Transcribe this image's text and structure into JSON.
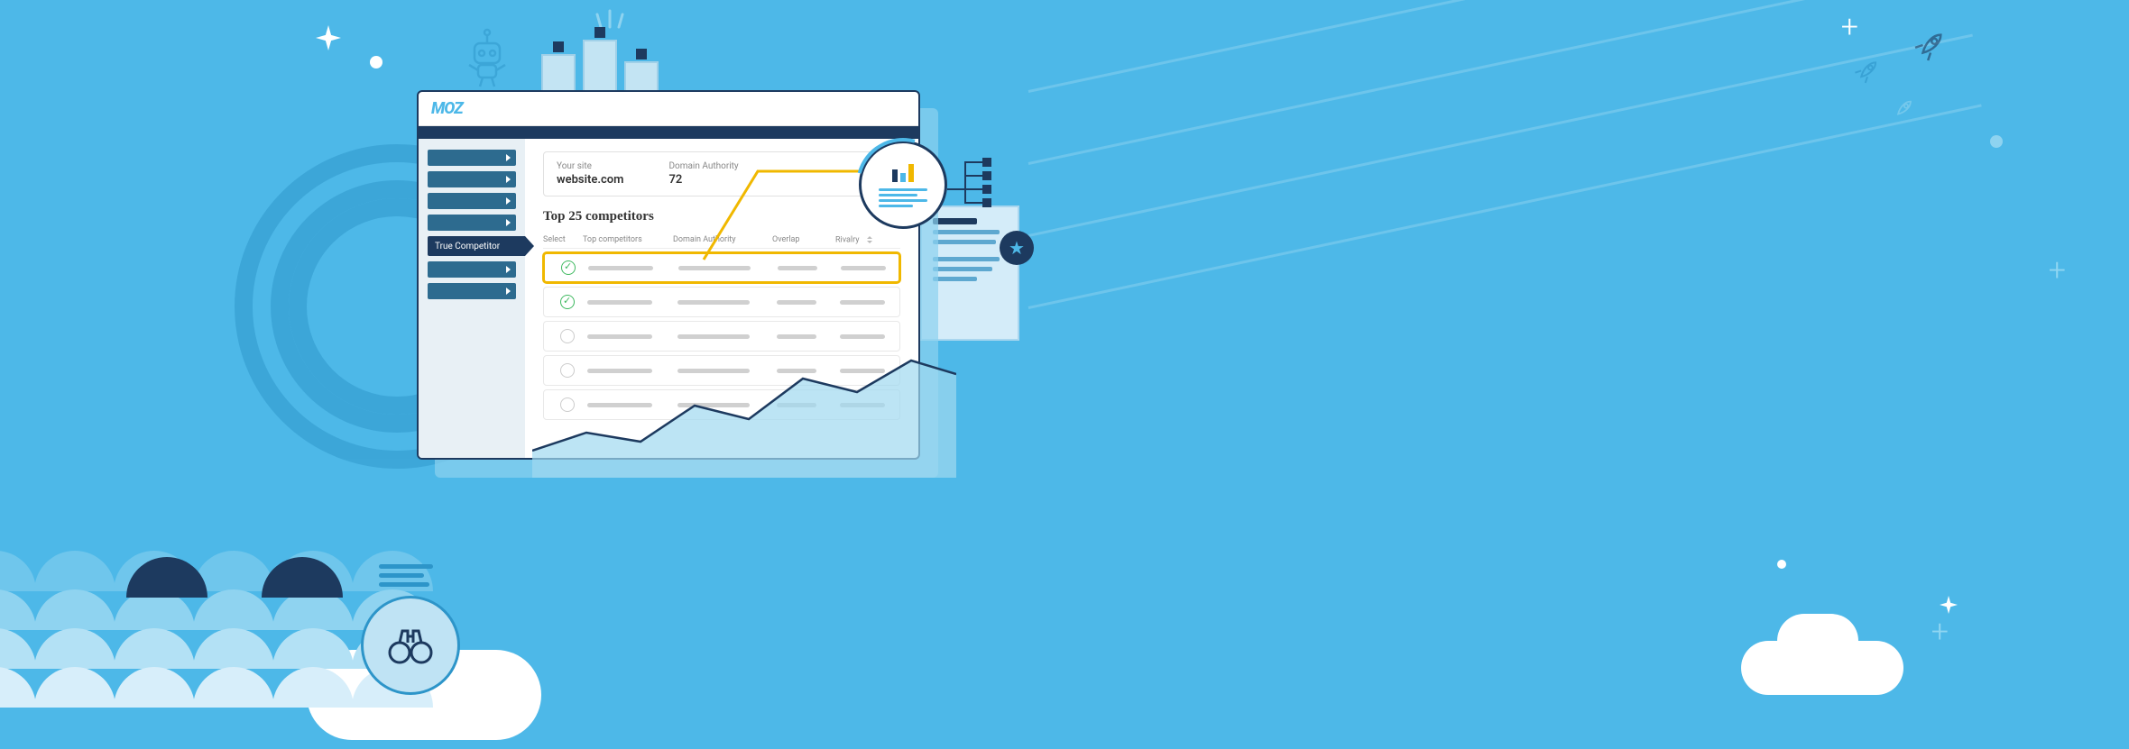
{
  "brand": "MOZ",
  "sidebar": {
    "active_label": "True Competitor"
  },
  "metrics": {
    "site_label": "Your site",
    "site_value": "website.com",
    "da_label": "Domain Authority",
    "da_value": "72"
  },
  "table": {
    "title": "Top 25 competitors",
    "columns": {
      "select": "Select",
      "top_competitors": "Top competitors",
      "domain_authority": "Domain Authority",
      "overlap": "Overlap",
      "rivalry": "Rivalry"
    },
    "rows": [
      {
        "selected": true,
        "highlighted": true
      },
      {
        "selected": true,
        "highlighted": false
      },
      {
        "selected": false,
        "highlighted": false
      },
      {
        "selected": false,
        "highlighted": false
      },
      {
        "selected": false,
        "highlighted": false
      }
    ]
  }
}
